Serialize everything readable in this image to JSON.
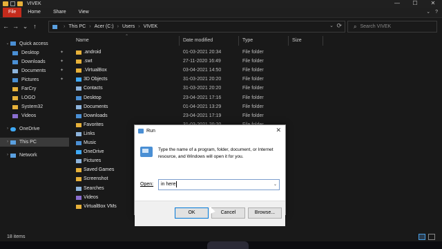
{
  "window": {
    "title": "VIVEK",
    "controls": [
      "—",
      "☐",
      "✕"
    ]
  },
  "ribbon": {
    "tabs": [
      "File",
      "Home",
      "Share",
      "View"
    ]
  },
  "address": {
    "crumbs": [
      "This PC",
      "Acer (C:)",
      "Users",
      "VIVEK"
    ],
    "search_placeholder": "Search VIVEK"
  },
  "sidebar": {
    "quick_access": "Quick access",
    "quick_items": [
      {
        "label": "Desktop",
        "pinned": true,
        "color": "#4a8fd4"
      },
      {
        "label": "Downloads",
        "pinned": true,
        "color": "#4a8fd4"
      },
      {
        "label": "Documents",
        "pinned": true,
        "color": "#8db4dd"
      },
      {
        "label": "Pictures",
        "pinned": true,
        "color": "#4a8fd4"
      },
      {
        "label": "FarCry",
        "pinned": false,
        "color": "#e7b13a"
      },
      {
        "label": "LOGO",
        "pinned": false,
        "color": "#e7b13a"
      },
      {
        "label": "System32",
        "pinned": false,
        "color": "#e7b13a"
      },
      {
        "label": "Videos",
        "pinned": false,
        "color": "#8a6ed0"
      }
    ],
    "onedrive": "OneDrive",
    "this_pc": "This PC",
    "network": "Network"
  },
  "columns": [
    "Name",
    "Date modified",
    "Type",
    "Size"
  ],
  "files": [
    {
      "name": ".android",
      "date": "01-03-2021 20:34",
      "type": "File folder",
      "color": "#e7b13a"
    },
    {
      "name": ".swt",
      "date": "27-11-2020 16:49",
      "type": "File folder",
      "color": "#e7b13a"
    },
    {
      "name": ".VirtualBox",
      "date": "03-04-2021 14:50",
      "type": "File folder",
      "color": "#e7b13a"
    },
    {
      "name": "3D Objects",
      "date": "31-03-2021 20:20",
      "type": "File folder",
      "color": "#3fa9f5"
    },
    {
      "name": "Contacts",
      "date": "31-03-2021 20:20",
      "type": "File folder",
      "color": "#8db4dd"
    },
    {
      "name": "Desktop",
      "date": "23-04-2021 17:16",
      "type": "File folder",
      "color": "#4a8fd4"
    },
    {
      "name": "Documents",
      "date": "01-04-2021 13:29",
      "type": "File folder",
      "color": "#8db4dd"
    },
    {
      "name": "Downloads",
      "date": "23-04-2021 17:19",
      "type": "File folder",
      "color": "#4a8fd4"
    },
    {
      "name": "Favorites",
      "date": "31-03-2021 20:20",
      "type": "File folder",
      "color": "#e7b13a"
    },
    {
      "name": "Links",
      "date": "",
      "type": "",
      "color": "#8db4dd"
    },
    {
      "name": "Music",
      "date": "",
      "type": "",
      "color": "#4a8fd4"
    },
    {
      "name": "OneDrive",
      "date": "",
      "type": "",
      "color": "#3fa9f5"
    },
    {
      "name": "Pictures",
      "date": "",
      "type": "",
      "color": "#8db4dd"
    },
    {
      "name": "Saved Games",
      "date": "",
      "type": "",
      "color": "#e7b13a"
    },
    {
      "name": "Screenshot",
      "date": "",
      "type": "",
      "color": "#e7b13a"
    },
    {
      "name": "Searches",
      "date": "",
      "type": "",
      "color": "#8db4dd"
    },
    {
      "name": "Videos",
      "date": "",
      "type": "",
      "color": "#8a6ed0"
    },
    {
      "name": "VirtualBox VMs",
      "date": "",
      "type": "",
      "color": "#e7b13a"
    }
  ],
  "status": {
    "count": "18 items"
  },
  "run_dialog": {
    "title": "Run",
    "message": "Type the name of a program, folder, document, or Internet resource, and Windows will open it for you.",
    "open_label": "Open:",
    "open_value": "in here",
    "ok": "OK",
    "cancel": "Cancel",
    "browse": "Browse..."
  }
}
